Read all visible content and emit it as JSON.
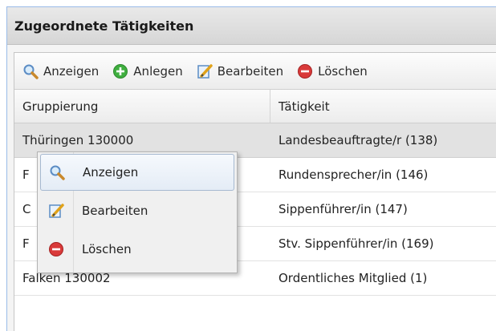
{
  "panel": {
    "title": "Zugeordnete Tätigkeiten"
  },
  "toolbar": {
    "view_label": "Anzeigen",
    "add_label": "Anlegen",
    "edit_label": "Bearbeiten",
    "delete_label": "Löschen"
  },
  "grid": {
    "columns": [
      "Gruppierung",
      "Tätigkeit"
    ],
    "rows": [
      {
        "gruppierung": "Thüringen 130000",
        "taetigkeit": "Landesbeauftragte/r (138)"
      },
      {
        "gruppierung": "F",
        "taetigkeit": "Rundensprecher/in (146)"
      },
      {
        "gruppierung": "C",
        "taetigkeit": "Sippenführer/in (147)"
      },
      {
        "gruppierung": "F",
        "taetigkeit": "Stv. Sippenführer/in (169)"
      },
      {
        "gruppierung": "Falken 130002",
        "taetigkeit": "Ordentliches Mitglied (1)"
      }
    ]
  },
  "context_menu": {
    "items": [
      {
        "label": "Anzeigen",
        "icon": "magnifier-icon"
      },
      {
        "label": "Bearbeiten",
        "icon": "edit-icon"
      },
      {
        "label": "Löschen",
        "icon": "delete-icon"
      }
    ]
  },
  "colors": {
    "header_border": "#99bbe8",
    "selected_row": "#e2e2e2",
    "add_green": "#3fae3f",
    "delete_red": "#d93a3a"
  }
}
